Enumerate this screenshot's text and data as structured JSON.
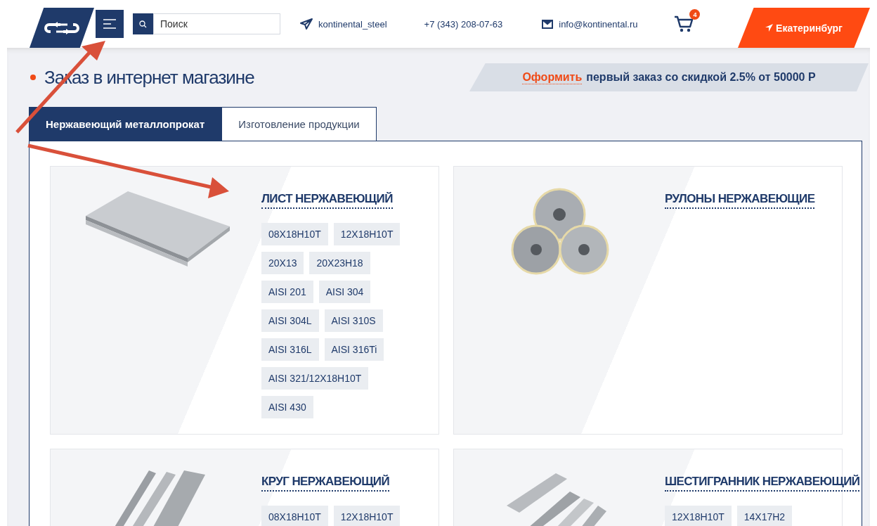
{
  "header": {
    "search": {
      "placeholder": "Поиск"
    },
    "telegram": "kontinental_steel",
    "phone": "+7 (343) 208-07-63",
    "email": "info@kontinental.ru",
    "cart_count": "4",
    "city": "Екатеринбург"
  },
  "page_title": "Заказ в интернет магазине",
  "promo": {
    "link": "Оформить",
    "text": "первый заказ со скидкой 2.5% от 50000 Р"
  },
  "tabs": [
    {
      "label": "Нержавеющий металлопрокат",
      "selected": true
    },
    {
      "label": "Изготовление продукции",
      "selected": false
    }
  ],
  "products": [
    {
      "kind": "sheet",
      "title": "ЛИСТ НЕРЖАВЕЮЩИЙ",
      "tags": [
        "08Х18Н10Т",
        "12Х18Н10Т",
        "20Х13",
        "20Х23Н18",
        "AISI 201",
        "AISI 304",
        "AISI 304L",
        "AISI 310S",
        "AISI 316L",
        "AISI 316Ti",
        "AISI 321/12Х18Н10Т",
        "AISI 430"
      ]
    },
    {
      "kind": "coil",
      "title": "РУЛОНЫ НЕРЖАВЕЮЩИЕ"
    },
    {
      "kind": "rod",
      "title": "КРУГ НЕРЖАВЕЮЩИЙ",
      "tags": [
        "08Х18Н10Т",
        "12Х18Н10Т"
      ]
    },
    {
      "kind": "hex",
      "title": "ШЕСТИГРАННИК НЕРЖАВЕЮЩИЙ",
      "tags": [
        "12Х18Н10Т",
        "14Х17Н2"
      ]
    }
  ]
}
